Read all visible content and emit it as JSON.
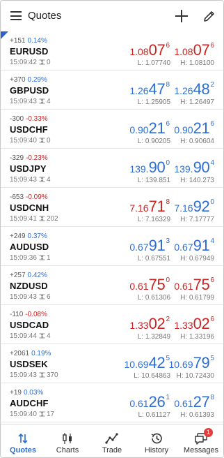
{
  "header": {
    "title": "Quotes"
  },
  "quotes": [
    {
      "change": "+151",
      "change_pct": "0.14%",
      "dir": "up",
      "symbol": "EURUSD",
      "time": "15:09:42",
      "spread": "0",
      "bid": {
        "a": "1.08",
        "b": "07",
        "c": "6",
        "color": "red"
      },
      "ask": {
        "a": "1.08",
        "b": "07",
        "c": "6",
        "color": "red"
      },
      "low": "L: 1.07740",
      "high": "H: 1.08100"
    },
    {
      "change": "+370",
      "change_pct": "0.29%",
      "dir": "up",
      "symbol": "GBPUSD",
      "time": "15:09:43",
      "spread": "4",
      "bid": {
        "a": "1.26",
        "b": "47",
        "c": "8",
        "color": "blue"
      },
      "ask": {
        "a": "1.26",
        "b": "48",
        "c": "2",
        "color": "blue"
      },
      "low": "L: 1.25905",
      "high": "H: 1.26497"
    },
    {
      "change": "-300",
      "change_pct": "-0.33%",
      "dir": "down",
      "symbol": "USDCHF",
      "time": "15:09:40",
      "spread": "0",
      "bid": {
        "a": "0.90",
        "b": "21",
        "c": "6",
        "color": "blue"
      },
      "ask": {
        "a": "0.90",
        "b": "21",
        "c": "6",
        "color": "blue"
      },
      "low": "L: 0.90205",
      "high": "H: 0.90604"
    },
    {
      "change": "-329",
      "change_pct": "-0.23%",
      "dir": "down",
      "symbol": "USDJPY",
      "time": "15:09:43",
      "spread": "4",
      "bid": {
        "a": "139.",
        "b": "90",
        "c": "0",
        "color": "blue"
      },
      "ask": {
        "a": "139.",
        "b": "90",
        "c": "4",
        "color": "blue"
      },
      "low": "L: 139.851",
      "high": "H: 140.273"
    },
    {
      "change": "-653",
      "change_pct": "-0.09%",
      "dir": "down",
      "symbol": "USDCNH",
      "time": "15:09:41",
      "spread": "202",
      "bid": {
        "a": "7.16",
        "b": "71",
        "c": "8",
        "color": "red"
      },
      "ask": {
        "a": "7.16",
        "b": "92",
        "c": "0",
        "color": "blue"
      },
      "low": "L: 7.16329",
      "high": "H: 7.17777"
    },
    {
      "change": "+249",
      "change_pct": "0.37%",
      "dir": "up",
      "symbol": "AUDUSD",
      "time": "15:09:36",
      "spread": "1",
      "bid": {
        "a": "0.67",
        "b": "91",
        "c": "3",
        "color": "blue"
      },
      "ask": {
        "a": "0.67",
        "b": "91",
        "c": "4",
        "color": "blue"
      },
      "low": "L: 0.67551",
      "high": "H: 0.67949"
    },
    {
      "change": "+257",
      "change_pct": "0.42%",
      "dir": "up",
      "symbol": "NZDUSD",
      "time": "15:09:43",
      "spread": "6",
      "bid": {
        "a": "0.61",
        "b": "75",
        "c": "0",
        "color": "red"
      },
      "ask": {
        "a": "0.61",
        "b": "75",
        "c": "6",
        "color": "red"
      },
      "low": "L: 0.61306",
      "high": "H: 0.61799"
    },
    {
      "change": "-110",
      "change_pct": "-0.08%",
      "dir": "down",
      "symbol": "USDCAD",
      "time": "15:09:44",
      "spread": "4",
      "bid": {
        "a": "1.33",
        "b": "02",
        "c": "2",
        "color": "red"
      },
      "ask": {
        "a": "1.33",
        "b": "02",
        "c": "6",
        "color": "red"
      },
      "low": "L: 1.32849",
      "high": "H: 1.33196"
    },
    {
      "change": "+2061",
      "change_pct": "0.19%",
      "dir": "up",
      "symbol": "USDSEK",
      "time": "15:09:43",
      "spread": "370",
      "bid": {
        "a": "10.69",
        "b": "42",
        "c": "5",
        "color": "blue"
      },
      "ask": {
        "a": "10.69",
        "b": "79",
        "c": "5",
        "color": "blue"
      },
      "low": "L: 10.64863",
      "high": "H: 10.72430"
    },
    {
      "change": "+19",
      "change_pct": "0.03%",
      "dir": "up",
      "symbol": "AUDCHF",
      "time": "15:09:40",
      "spread": "17",
      "bid": {
        "a": "0.61",
        "b": "26",
        "c": "1",
        "color": "blue"
      },
      "ask": {
        "a": "0.61",
        "b": "27",
        "c": "8",
        "color": "blue"
      },
      "low": "L: 0.61127",
      "high": "H: 0.61393"
    }
  ],
  "nav": {
    "quotes": "Quotes",
    "charts": "Charts",
    "trade": "Trade",
    "history": "History",
    "messages": "Messages",
    "messages_badge": "1"
  },
  "colors": {
    "accent": "#2d6cd1",
    "up": "#2d6cd1",
    "down": "#cc2222",
    "badge": "#e03e3e"
  }
}
